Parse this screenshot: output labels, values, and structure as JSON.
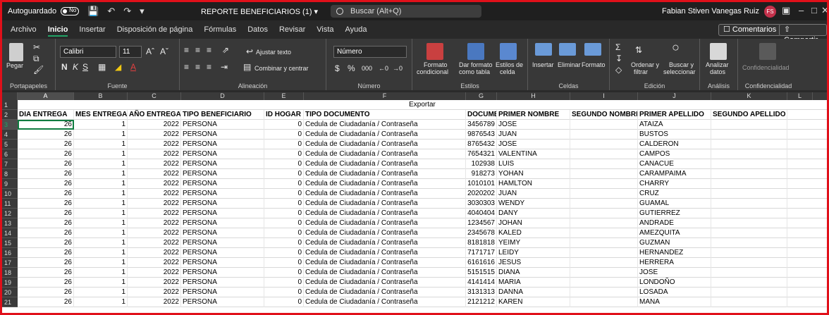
{
  "titlebar": {
    "autosave": "Autoguardado",
    "toggle_state": "No",
    "doc_title": "REPORTE BENEFICIARIOS (1) ▾",
    "search_placeholder": "Buscar (Alt+Q)",
    "user_name": "Fabian Stiven Vanegas Ruiz",
    "user_initials": "FS"
  },
  "menu": {
    "items": [
      "Archivo",
      "Inicio",
      "Insertar",
      "Disposición de página",
      "Fórmulas",
      "Datos",
      "Revisar",
      "Vista",
      "Ayuda"
    ],
    "comments_label": "☐ Comentarios",
    "share_label": "⇧ Compartir"
  },
  "ribbon": {
    "paste_label": "Pegar",
    "clipboard_group": "Portapapeles",
    "font_name": "Calibri",
    "font_size": "11",
    "font_group": "Fuente",
    "wrap_text": "Ajustar texto",
    "merge_center": "Combinar y centrar",
    "alignment_group": "Alineación",
    "number_format": "Número",
    "number_group": "Número",
    "cond_format_1": "Formato",
    "cond_format_2": "condicional",
    "format_table_1": "Dar formato",
    "format_table_2": "como tabla",
    "cell_styles_1": "Estilos de",
    "cell_styles_2": "celda",
    "styles_group": "Estilos",
    "insert_label": "Insertar",
    "delete_label": "Eliminar",
    "format_label": "Formato",
    "cells_group": "Celdas",
    "sort_filter_1": "Ordenar y",
    "sort_filter_2": "filtrar",
    "find_select_1": "Buscar y",
    "find_select_2": "seleccionar",
    "editing_group": "Edición",
    "analyze_1": "Analizar",
    "analyze_2": "datos",
    "analysis_group": "Análisis",
    "sensitivity_label": "Confidencialidad",
    "sensitivity_group": "Confidencialidad"
  },
  "grid": {
    "columns": [
      "A",
      "B",
      "C",
      "D",
      "E",
      "F",
      "G",
      "H",
      "I",
      "J",
      "K",
      "L"
    ],
    "selected_column": "A",
    "export_label": "Exportar",
    "headers": [
      "DIA ENTREGA",
      "MES ENTREGA",
      "AÑO ENTREGA",
      "TIPO BENEFICIARIO",
      "ID HOGAR",
      "TIPO DOCUMENTO",
      "DOCUMENTO",
      "PRIMER NOMBRE",
      "SEGUNDO NOMBRE",
      "PRIMER APELLIDO",
      "SEGUNDO APELLIDO"
    ],
    "selected_row": 3,
    "rows": [
      [
        "26",
        "1",
        "2022",
        "PERSONA",
        "0",
        "Cedula de Ciudadanía / Contraseña",
        "3456789",
        "JOSE",
        "",
        "ATAIZA",
        ""
      ],
      [
        "26",
        "1",
        "2022",
        "PERSONA",
        "0",
        "Cedula de Ciudadanía / Contraseña",
        "9876543",
        "JUAN",
        "",
        "BUSTOS",
        ""
      ],
      [
        "26",
        "1",
        "2022",
        "PERSONA",
        "0",
        "Cedula de Ciudadanía / Contraseña",
        "8765432",
        "JOSE",
        "",
        "CALDERON",
        ""
      ],
      [
        "26",
        "1",
        "2022",
        "PERSONA",
        "0",
        "Cedula de Ciudadanía / Contraseña",
        "7654321",
        "VALENTINA",
        "",
        "CAMPOS",
        ""
      ],
      [
        "26",
        "1",
        "2022",
        "PERSONA",
        "0",
        "Cedula de Ciudadanía / Contraseña",
        "102938",
        "LUIS",
        "",
        "CANACUE",
        ""
      ],
      [
        "26",
        "1",
        "2022",
        "PERSONA",
        "0",
        "Cedula de Ciudadanía / Contraseña",
        "918273",
        "YOHAN",
        "",
        "CARAMPAIMA",
        ""
      ],
      [
        "26",
        "1",
        "2022",
        "PERSONA",
        "0",
        "Cedula de Ciudadanía / Contraseña",
        "1010101",
        "HAMLTON",
        "",
        "CHARRY",
        ""
      ],
      [
        "26",
        "1",
        "2022",
        "PERSONA",
        "0",
        "Cedula de Ciudadanía / Contraseña",
        "2020202",
        "JUAN",
        "",
        "CRUZ",
        ""
      ],
      [
        "26",
        "1",
        "2022",
        "PERSONA",
        "0",
        "Cedula de Ciudadanía / Contraseña",
        "3030303",
        "WENDY",
        "",
        "GUAMAL",
        ""
      ],
      [
        "26",
        "1",
        "2022",
        "PERSONA",
        "0",
        "Cedula de Ciudadanía / Contraseña",
        "4040404",
        "DANY",
        "",
        "GUTIERREZ",
        ""
      ],
      [
        "26",
        "1",
        "2022",
        "PERSONA",
        "0",
        "Cedula de Ciudadanía / Contraseña",
        "1234567",
        "JOHAN",
        "",
        "ANDRADE",
        ""
      ],
      [
        "26",
        "1",
        "2022",
        "PERSONA",
        "0",
        "Cedula de Ciudadanía / Contraseña",
        "2345678",
        "KALED",
        "",
        "AMEZQUITA",
        ""
      ],
      [
        "26",
        "1",
        "2022",
        "PERSONA",
        "0",
        "Cedula de Ciudadanía / Contraseña",
        "8181818",
        "YEIMY",
        "",
        "GUZMAN",
        ""
      ],
      [
        "26",
        "1",
        "2022",
        "PERSONA",
        "0",
        "Cedula de Ciudadanía / Contraseña",
        "7171717",
        "LEIDY",
        "",
        "HERNANDEZ",
        ""
      ],
      [
        "26",
        "1",
        "2022",
        "PERSONA",
        "0",
        "Cedula de Ciudadanía / Contraseña",
        "6161616",
        "JESUS",
        "",
        "HERRERA",
        ""
      ],
      [
        "26",
        "1",
        "2022",
        "PERSONA",
        "0",
        "Cedula de Ciudadanía / Contraseña",
        "5151515",
        "DIANA",
        "",
        "JOSE",
        ""
      ],
      [
        "26",
        "1",
        "2022",
        "PERSONA",
        "0",
        "Cedula de Ciudadanía / Contraseña",
        "4141414",
        "MARIA",
        "",
        "LONDOÑO",
        ""
      ],
      [
        "26",
        "1",
        "2022",
        "PERSONA",
        "0",
        "Cedula de Ciudadanía / Contraseña",
        "3131313",
        "DANNA",
        "",
        "LOSADA",
        ""
      ],
      [
        "26",
        "1",
        "2022",
        "PERSONA",
        "0",
        "Cedula de Ciudadanía / Contraseña",
        "2121212",
        "KAREN",
        "",
        "MANA",
        ""
      ]
    ]
  },
  "colors": {
    "accent": "#21a366",
    "border": "#e0101a",
    "avatar": "#c4314b"
  }
}
